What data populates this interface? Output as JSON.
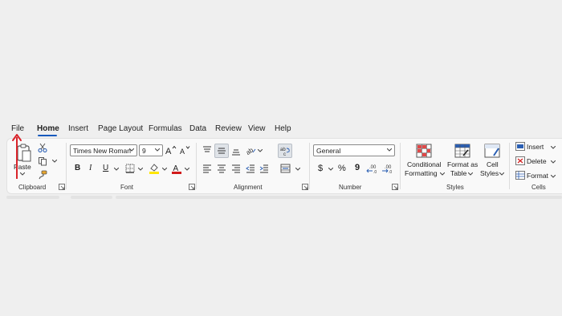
{
  "tabs": [
    "File",
    "Home",
    "Insert",
    "Page Layout",
    "Formulas",
    "Data",
    "Review",
    "View",
    "Help"
  ],
  "active_tab": "Home",
  "clipboard": {
    "paste_label": "Paste",
    "group_label": "Clipboard"
  },
  "font": {
    "name": "Times New Roman",
    "size": "9",
    "bold": "B",
    "italic": "I",
    "underline": "U",
    "group_label": "Font",
    "fill_color": "#ffe600",
    "text_color": "#d11a1a"
  },
  "alignment": {
    "group_label": "Alignment"
  },
  "number": {
    "format": "General",
    "currency": "$",
    "percent": "%",
    "comma": "9",
    "group_label": "Number"
  },
  "styles": {
    "conditional_line1": "Conditional",
    "conditional_line2": "Formatting",
    "format_table_line1": "Format as",
    "format_table_line2": "Table",
    "cell_styles_line1": "Cell",
    "cell_styles_line2": "Styles",
    "group_label": "Styles"
  },
  "cells": {
    "insert": "Insert",
    "delete": "Delete",
    "format": "Format",
    "group_label": "Cells"
  },
  "colors": {
    "accent": "#185abd",
    "arrow": "#d9232a"
  },
  "icons": [
    "cut-icon",
    "copy-icon",
    "format-painter-icon",
    "increase-font-icon",
    "decrease-font-icon",
    "borders-icon",
    "fill-color-icon",
    "font-color-icon",
    "align-top-icon",
    "align-middle-icon",
    "align-bottom-icon",
    "orientation-icon",
    "wrap-text-icon",
    "align-left-icon",
    "align-center-icon",
    "align-right-icon",
    "decrease-indent-icon",
    "increase-indent-icon",
    "merge-center-icon",
    "increase-decimal-icon",
    "decrease-decimal-icon",
    "conditional-formatting-icon",
    "format-as-table-icon",
    "cell-styles-icon",
    "insert-cells-icon",
    "delete-cells-icon",
    "format-cells-icon"
  ]
}
